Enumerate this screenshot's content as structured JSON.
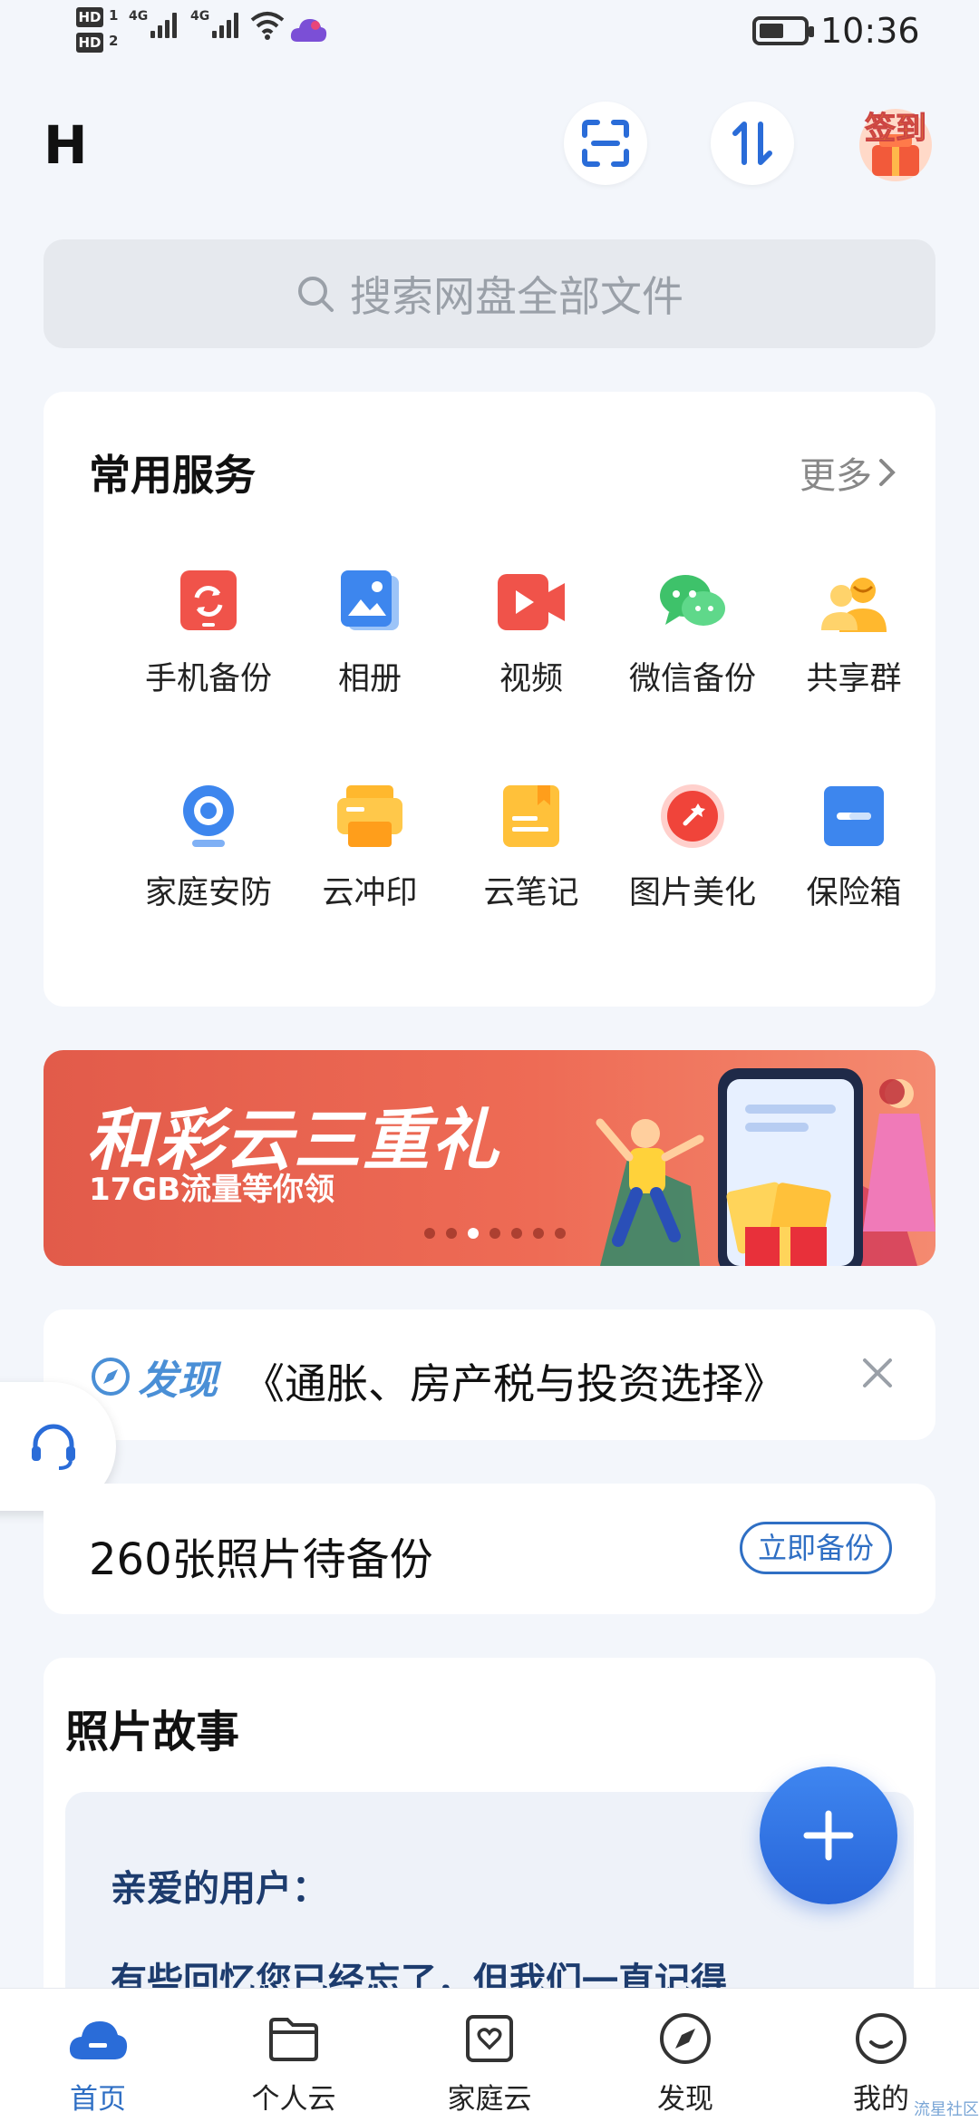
{
  "status_bar": {
    "sim1": "HD",
    "sim1_num": "1",
    "sim2": "HD",
    "sim2_num": "2",
    "net1": "4G",
    "net2": "4G",
    "time": "10:36"
  },
  "header": {
    "initial": "H",
    "checkin_label": "签到"
  },
  "search": {
    "placeholder": "搜索网盘全部文件"
  },
  "services": {
    "title": "常用服务",
    "more_label": "更多",
    "items": [
      {
        "label": "手机备份",
        "icon": "phone-backup-icon"
      },
      {
        "label": "相册",
        "icon": "album-icon"
      },
      {
        "label": "视频",
        "icon": "video-icon"
      },
      {
        "label": "微信备份",
        "icon": "wechat-icon"
      },
      {
        "label": "共享群",
        "icon": "share-group-icon"
      },
      {
        "label": "家庭安防",
        "icon": "home-camera-icon"
      },
      {
        "label": "云冲印",
        "icon": "cloud-print-icon"
      },
      {
        "label": "云笔记",
        "icon": "cloud-note-icon"
      },
      {
        "label": "图片美化",
        "icon": "photo-beautify-icon"
      },
      {
        "label": "保险箱",
        "icon": "safe-box-icon"
      }
    ]
  },
  "banner": {
    "title": "和彩云三重礼",
    "subtitle": "17GB流量等你领",
    "slide_count": 7,
    "active_index": 2
  },
  "discover": {
    "tag": "发现",
    "text": "《通胀、房产税与投资选择》"
  },
  "backup": {
    "text": "260张照片待备份",
    "button": "立即备份"
  },
  "story": {
    "title": "照片故事",
    "greeting": "亲爱的用户：",
    "line": "有些回忆您已经忘了，但我们一直记得"
  },
  "bottom_nav": {
    "items": [
      {
        "label": "首页",
        "icon": "cloud-home-icon",
        "active": true
      },
      {
        "label": "个人云",
        "icon": "folder-icon",
        "active": false
      },
      {
        "label": "家庭云",
        "icon": "family-heart-icon",
        "active": false
      },
      {
        "label": "发现",
        "icon": "compass-icon",
        "active": false
      },
      {
        "label": "我的",
        "icon": "smile-icon",
        "active": false
      }
    ]
  },
  "watermark": "流星社区",
  "colors": {
    "accent": "#2f6fc4",
    "banner": "#e25b4a",
    "background": "#f3f6fb"
  }
}
